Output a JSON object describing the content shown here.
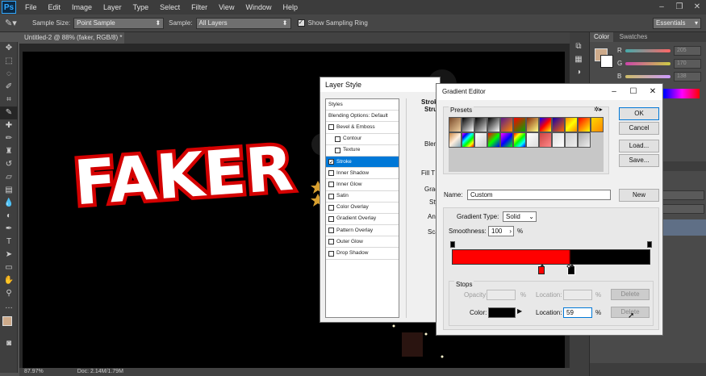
{
  "menubar": {
    "logo": "Ps",
    "items": [
      "File",
      "Edit",
      "Image",
      "Layer",
      "Type",
      "Select",
      "Filter",
      "View",
      "Window",
      "Help"
    ],
    "window_controls": [
      "–",
      "❐",
      "✕"
    ]
  },
  "options_bar": {
    "sample_size_label": "Sample Size:",
    "sample_size_value": "Point Sample",
    "sample_label": "Sample:",
    "sample_value": "All Layers",
    "show_ring_label": "Show Sampling Ring",
    "workspace": "Essentials"
  },
  "document": {
    "tab_title": "Untitled-2 @ 88% (faker, RGB/8) *",
    "zoom": "87.97%",
    "doc_info": "Doc: 2.14M/1.79M",
    "artwork_text": "FAKER"
  },
  "color_panel": {
    "tabs": [
      "Color",
      "Swatches"
    ],
    "channels": [
      {
        "name": "R",
        "value": "205"
      },
      {
        "name": "G",
        "value": "170"
      },
      {
        "name": "B",
        "value": "138"
      }
    ],
    "foreground_color": "#cdaa8a"
  },
  "layer_style": {
    "title": "Layer Style",
    "header": "Styles",
    "items": [
      {
        "label": "Blending Options: Default",
        "checkbox": false,
        "checked": false,
        "sub": false,
        "selected": false
      },
      {
        "label": "Bevel & Emboss",
        "checkbox": true,
        "checked": false,
        "sub": false,
        "selected": false
      },
      {
        "label": "Contour",
        "checkbox": true,
        "checked": false,
        "sub": true,
        "selected": false
      },
      {
        "label": "Texture",
        "checkbox": true,
        "checked": false,
        "sub": true,
        "selected": false
      },
      {
        "label": "Stroke",
        "checkbox": true,
        "checked": true,
        "sub": false,
        "selected": true
      },
      {
        "label": "Inner Shadow",
        "checkbox": true,
        "checked": false,
        "sub": false,
        "selected": false
      },
      {
        "label": "Inner Glow",
        "checkbox": true,
        "checked": false,
        "sub": false,
        "selected": false
      },
      {
        "label": "Satin",
        "checkbox": true,
        "checked": false,
        "sub": false,
        "selected": false
      },
      {
        "label": "Color Overlay",
        "checkbox": true,
        "checked": false,
        "sub": false,
        "selected": false
      },
      {
        "label": "Gradient Overlay",
        "checkbox": true,
        "checked": false,
        "sub": false,
        "selected": false
      },
      {
        "label": "Pattern Overlay",
        "checkbox": true,
        "checked": false,
        "sub": false,
        "selected": false
      },
      {
        "label": "Outer Glow",
        "checkbox": true,
        "checked": false,
        "sub": false,
        "selected": false
      },
      {
        "label": "Drop Shadow",
        "checkbox": true,
        "checked": false,
        "sub": false,
        "selected": false
      }
    ],
    "right_labels": {
      "stroke": "Strok",
      "struct": "Stru",
      "fill": "Fill T",
      "gradi": "Gradi",
      "sty": "Sty",
      "ang": "Ang",
      "sca": "Sca",
      "blen": "Blen"
    }
  },
  "gradient_editor": {
    "title": "Gradient Editor",
    "presets_label": "Presets",
    "buttons": {
      "ok": "OK",
      "cancel": "Cancel",
      "load": "Load...",
      "save": "Save...",
      "new": "New"
    },
    "name_label": "Name:",
    "name_value": "Custom",
    "gradient_type_label": "Gradient Type:",
    "gradient_type_value": "Solid",
    "smoothness_label": "Smoothness:",
    "smoothness_value": "100",
    "percent": "%",
    "stops_label": "Stops",
    "opacity_label": "Opacity:",
    "opacity_location_label": "Location:",
    "delete_label": "Delete",
    "color_label": "Color:",
    "color_location_label": "Location:",
    "color_location_value": "59",
    "stop_color": "#000000",
    "gradient_start": "#ff0000",
    "gradient_end": "#000000",
    "color_stop_locations": [
      0.59,
      0.6
    ],
    "midpoint_location": 0.62
  }
}
